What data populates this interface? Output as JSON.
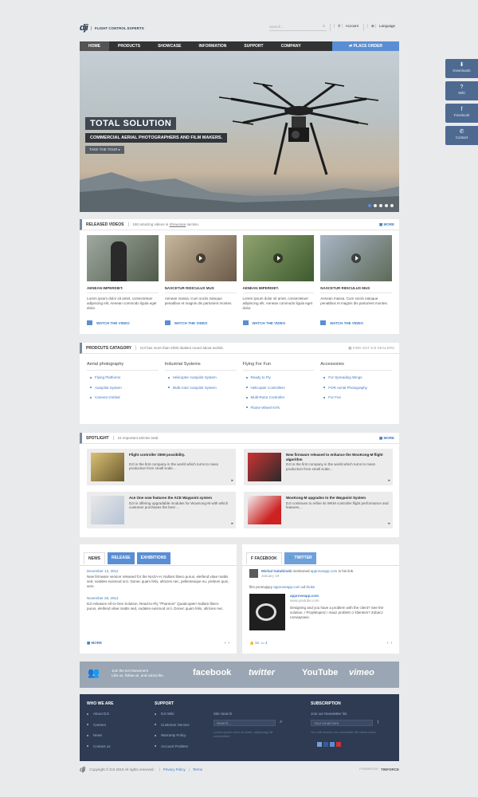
{
  "header": {
    "logo": "dji",
    "tagline": "FLIGHT CONTROL EXPERTS",
    "search_placeholder": "Search...",
    "account": "Account",
    "language": "Language"
  },
  "nav": {
    "items": [
      "HOME",
      "PRODUCTS",
      "SHOWCASE",
      "INFORMATION",
      "SUPPORT",
      "COMPANY"
    ],
    "order": "PLACE ORDER"
  },
  "hero": {
    "title": "TOTAL SOLUTION",
    "subtitle": "COMMERCIAL AERIAL PHOTOGRAPHERS AND FILM MAKERS.",
    "cta": "TAKE THE TOUR"
  },
  "sidebar": [
    "Downloads",
    "Wiki",
    "Facebook",
    "Contact"
  ],
  "videos": {
    "title": "RELEASED VIDEOS",
    "desc_pre": "160 amazing videos in ",
    "desc_link": "Showcase",
    "desc_post": " section.",
    "more": "MORE",
    "watch": "WATCH THE VIDEO",
    "items": [
      {
        "title": "AENEAN IMPERDIET.",
        "text": "Lorem ipsum dolor sit amet, consectetuer adipiscing elit. Aenean commodo ligula eget dolor."
      },
      {
        "title": "NASCETUR RIDICULUS MUS",
        "text": "Aenean massa. Cum sociis natoque penatibus et magnis dis parturient montes."
      },
      {
        "title": "AENEAN IMPERDIET.",
        "text": "Lorem ipsum dolor sit amet, consectetuer adipiscing elit. Aenean commodo ligula eget dolor."
      },
      {
        "title": "NASCETUR RIDICULUS MUS",
        "text": "Aenean massa. Cum sociis natoque penatibus et magnis dis parturient montes."
      }
    ]
  },
  "categories": {
    "title": "PRODCUTS CATAGORY",
    "desc": "DJI has more than 2000 dealers round about worlds.",
    "more": "FIND OUT DJI DEALERS",
    "cols": [
      {
        "title": "Aerial photography",
        "items": [
          "Flying Platforms",
          "Autopilot System",
          "Camera Gimbal"
        ]
      },
      {
        "title": "Industrial Systems",
        "items": [
          "Helicopter Autopilot System",
          "Multi-rotor Autopilot System"
        ]
      },
      {
        "title": "Flying For Fun",
        "items": [
          "Ready to Fly",
          "Helicopter Controllers",
          "Multi-Rotor Controller",
          "Flame Wheel KITs"
        ]
      },
      {
        "title": "Accessories",
        "items": [
          "For Spreading Wings",
          "FOR Aerial Photography",
          "For Fun"
        ]
      }
    ]
  },
  "spotlight": {
    "title": "SPOTLIGHT",
    "desc": "24 Important articles total.",
    "more": "MORE",
    "items": [
      {
        "title": "Flight controller OEM possibility.",
        "text": "DJI is the first company in the world which turns to mass production from small scale..."
      },
      {
        "title": "New firmware released to enhance the WooKong-M flight algorithm",
        "text": "DJI is the first company in the world which turns to mass production from small scale..."
      },
      {
        "title": "Ace One now features the ACE Waypoint system",
        "text": "DJI is offering upgradable modules for WooKong-M with which customer purchases the best ..."
      },
      {
        "title": "WooKong-M upgrades to the Waypoint System",
        "text": "DJI continues to refine its WKM controller flight performance and features..."
      }
    ]
  },
  "news": {
    "tabs": [
      "NEWS",
      "RELEASE",
      "EXHIBITIONS"
    ],
    "items": [
      {
        "date": "December 13, 2012",
        "text": "New firmware version released for the NAZA-H, Nullam libero purus, eleifend vitae mattis sed, sodales euismod orci. Donec quam felis, ultricies nec, pellentesque eu, pretium quis, sem."
      },
      {
        "date": "November 28, 2012",
        "text": "DJI releases All-in-One Solution, Read-to-Fly \"Phantom\" Quadcopter! Nullam libero purus, eleifend vitae mattis sed, sodales euismod orci. Donec quam felis, ultricies nec."
      }
    ],
    "more": "MORE"
  },
  "social": {
    "tabs": [
      "FACEBOOK",
      "TWITTER"
    ],
    "author": "Michal Galubinski",
    "action": " mentioned ",
    "target": "approveapp.com",
    "action_end": " in his link.",
    "time": "January 19",
    "post_pre": "film promujący ",
    "post_link1": "approveapp.com",
    "post_mid": " od ",
    "post_link2": "thoke",
    "card_title": "approveapp.com",
    "card_url": "www.youtube.com",
    "card_text": "Designing and you have a problem with the client? See the solution. / Projektujesz i masz problem z klientem? Zobacz rozwiązanie.",
    "likes": "13",
    "comments": "4"
  },
  "band": {
    "join1": "Join the DJI Movement",
    "join2": "Like us, follow us, and subscribe.",
    "brands": [
      "facebook",
      "twitter",
      "YouTube",
      "vimeo"
    ]
  },
  "footer": {
    "who": {
      "title": "WHO WE ARE",
      "items": [
        "About DJI",
        "Careers",
        "News",
        "Contact us"
      ]
    },
    "support": {
      "title": "SUPPORT",
      "items": [
        "DJI Wiki",
        "Customer Service",
        "Warranty Policy",
        "Account Problem"
      ]
    },
    "search_label": "Site Search",
    "search_placeholder": "Search...",
    "search_hint": "Lorem ipsum dolor sit amet, adipiscing elit consectetur",
    "subscription": {
      "title": "SUBSCRIPTION",
      "label": "Join our Newsletter list",
      "placeholder": "Your email here",
      "hint": "You will receive our newsletter the latest news"
    }
  },
  "copyright": {
    "text": "Copyright © DJI 2010 All rights reserved.",
    "privacy": "Privacy Policy",
    "terms": "Terms",
    "powered": "POWERED BY",
    "powered_brand": "TINFORCE"
  },
  "colors": {
    "accent": "#5a8ed4",
    "nav": "#333333",
    "footer": "#2e3b53",
    "band": "#9aa6b3"
  }
}
